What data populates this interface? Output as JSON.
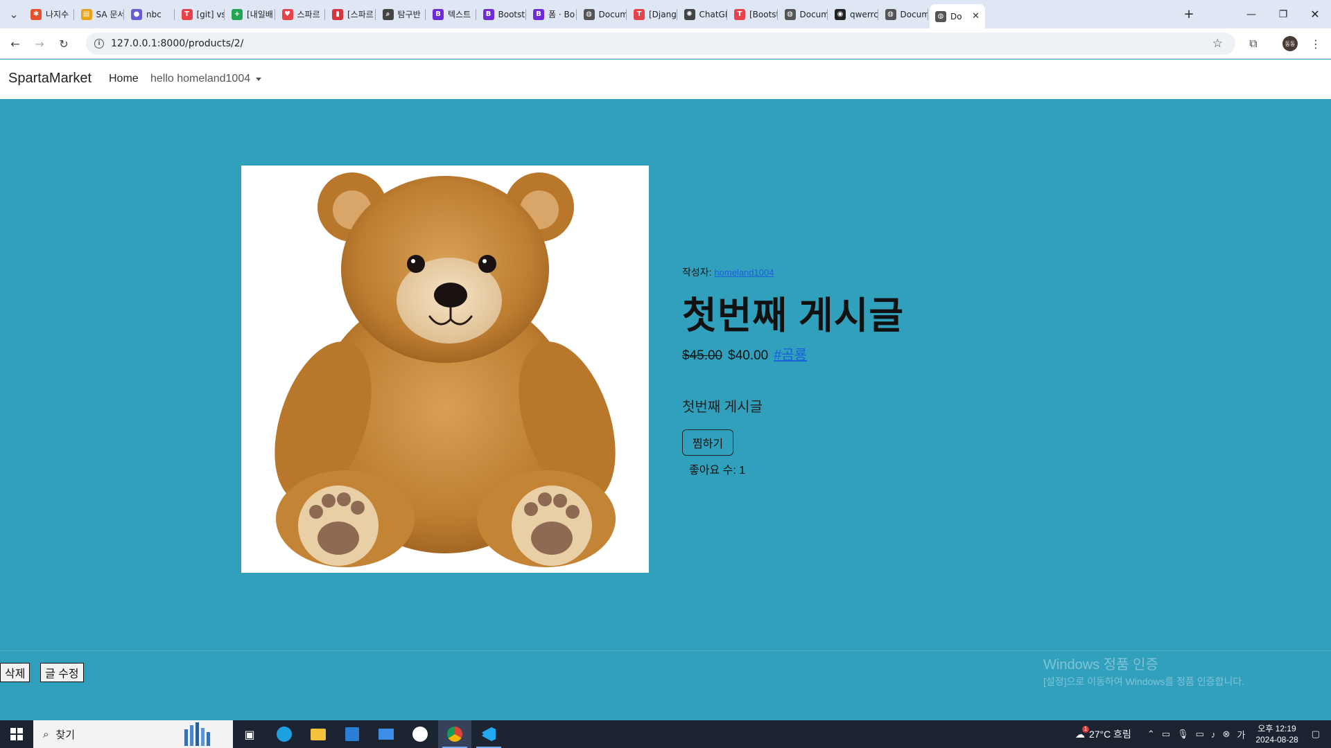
{
  "browser": {
    "tabs": [
      {
        "title": "나지수",
        "color": "#e84f2d",
        "glyph": "✱"
      },
      {
        "title": "SA 문서",
        "color": "#e8a317",
        "glyph": "▤"
      },
      {
        "title": "nbc",
        "color": "#6b5bd6",
        "glyph": "●"
      },
      {
        "title": "[git] vs",
        "color": "#e8434b",
        "glyph": "T"
      },
      {
        "title": "[내일배",
        "color": "#23a455",
        "glyph": "+"
      },
      {
        "title": "스파르",
        "color": "#e8434b",
        "glyph": "♥"
      },
      {
        "title": "[스파르",
        "color": "#d8343b",
        "glyph": "▮"
      },
      {
        "title": "탐구반",
        "color": "#444444",
        "glyph": "⌕"
      },
      {
        "title": "텍스트",
        "color": "#6f2bd9",
        "glyph": "B"
      },
      {
        "title": "Bootstr",
        "color": "#6f2bd9",
        "glyph": "B"
      },
      {
        "title": "폼 · Bo",
        "color": "#6f2bd9",
        "glyph": "B"
      },
      {
        "title": "Docum",
        "color": "#555555",
        "glyph": "◍"
      },
      {
        "title": "[Djang",
        "color": "#e8434b",
        "glyph": "T"
      },
      {
        "title": "ChatGP",
        "color": "#444444",
        "glyph": "✺"
      },
      {
        "title": "[Bootst",
        "color": "#e8434b",
        "glyph": "T"
      },
      {
        "title": "Docum",
        "color": "#555555",
        "glyph": "◍"
      },
      {
        "title": "qwerrc",
        "color": "#222222",
        "glyph": "◉"
      },
      {
        "title": "Docum",
        "color": "#555555",
        "glyph": "◍"
      },
      {
        "title": "Do",
        "color": "#555555",
        "glyph": "◍"
      }
    ],
    "new_tab": "+",
    "url": "127.0.0.1:8000/products/2/",
    "profile_initials": "동동"
  },
  "site": {
    "brand": "SpartaMarket",
    "nav_home": "Home",
    "nav_user": "hello homeland1004"
  },
  "product": {
    "image_alt": "teddy bear",
    "author_label": "작성자:",
    "author": "homeland1004",
    "title": "첫번째 게시글",
    "old_price": "$45.00",
    "price": "$40.00",
    "hashtag": "#곰룡",
    "body": "첫번째 게시글",
    "like_button": "찜하기",
    "like_count": "좋아요 수: 1"
  },
  "actions": {
    "delete": "삭제",
    "edit": "글 수정"
  },
  "watermark": {
    "title": "Windows 정품 인증",
    "subtitle": "[설정]으로 이동하여 Windows를 정품 인증합니다."
  },
  "taskbar": {
    "search_placeholder": "찾기",
    "weather": "27°C 흐림",
    "weather_badge": "1",
    "time": "오후 12:19",
    "date": "2024-08-28"
  }
}
